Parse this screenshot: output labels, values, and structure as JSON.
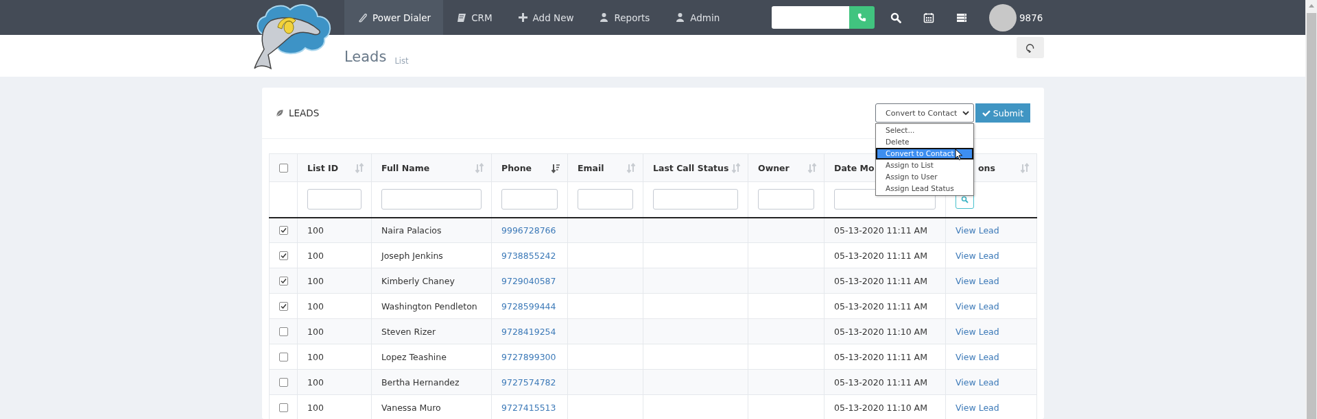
{
  "nav": {
    "items": [
      {
        "label": "Power Dialer",
        "selected": true
      },
      {
        "label": "CRM",
        "selected": false
      },
      {
        "label": "Add New",
        "selected": false
      },
      {
        "label": "Reports",
        "selected": false
      },
      {
        "label": "Admin",
        "selected": false
      }
    ]
  },
  "user": {
    "extension": "9876"
  },
  "page_header": {
    "title": "Leads",
    "subtitle": "List"
  },
  "card": {
    "title": "LEADS",
    "bulk_action": {
      "value": "Convert to Contact",
      "expanded": true,
      "options": [
        {
          "label": "Select...",
          "selected": false
        },
        {
          "label": "Delete",
          "selected": false
        },
        {
          "label": "Convert to Contact",
          "selected": true
        },
        {
          "label": "Assign to List",
          "selected": false
        },
        {
          "label": "Assign to User",
          "selected": false
        },
        {
          "label": "Assign Lead Status",
          "selected": false
        }
      ],
      "submit": "Submit"
    }
  },
  "table": {
    "select_all_checked": false,
    "columns": [
      {
        "label": "List ID",
        "sorted": false
      },
      {
        "label": "Full Name",
        "sorted": false
      },
      {
        "label": "Phone",
        "sorted": true
      },
      {
        "label": "Email",
        "sorted": false
      },
      {
        "label": "Last Call Status",
        "sorted": false
      },
      {
        "label": "Owner",
        "sorted": false
      },
      {
        "label": "Date Mo"
      },
      {
        "label": "ons",
        "sorted": false
      }
    ],
    "rows": [
      {
        "checked": true,
        "list_id": "100",
        "full_name": "Naira Palacios",
        "phone": "9996728766",
        "date_modified": "05-13-2020 11:11 AM",
        "action": "View Lead"
      },
      {
        "checked": true,
        "list_id": "100",
        "full_name": "Joseph Jenkins",
        "phone": "9738855242",
        "date_modified": "05-13-2020 11:11 AM",
        "action": "View Lead"
      },
      {
        "checked": true,
        "list_id": "100",
        "full_name": "Kimberly Chaney",
        "phone": "9729040587",
        "date_modified": "05-13-2020 11:11 AM",
        "action": "View Lead"
      },
      {
        "checked": true,
        "list_id": "100",
        "full_name": "Washington Pendleton",
        "phone": "9728599444",
        "date_modified": "05-13-2020 11:11 AM",
        "action": "View Lead"
      },
      {
        "checked": false,
        "list_id": "100",
        "full_name": "Steven Rizer",
        "phone": "9728419254",
        "date_modified": "05-13-2020 11:10 AM",
        "action": "View Lead"
      },
      {
        "checked": false,
        "list_id": "100",
        "full_name": "Lopez Teashine",
        "phone": "9727899300",
        "date_modified": "05-13-2020 11:11 AM",
        "action": "View Lead"
      },
      {
        "checked": false,
        "list_id": "100",
        "full_name": "Bertha Hernandez",
        "phone": "9727574782",
        "date_modified": "05-13-2020 11:11 AM",
        "action": "View Lead"
      },
      {
        "checked": false,
        "list_id": "100",
        "full_name": "Vanessa Muro",
        "phone": "9727415513",
        "date_modified": "05-13-2020 11:10 AM",
        "action": "View Lead"
      }
    ]
  }
}
